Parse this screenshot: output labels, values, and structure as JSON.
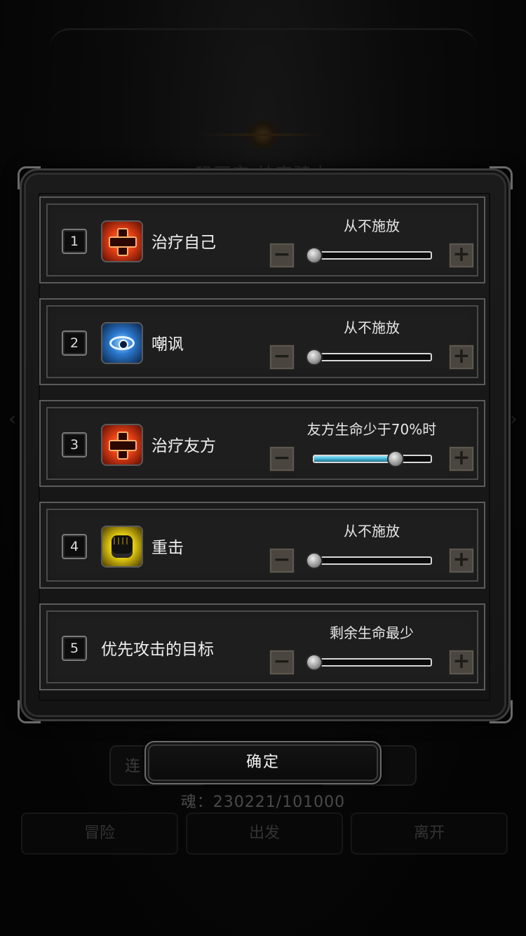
{
  "background": {
    "title": "玛丽安 神官骑士",
    "left_button": "连",
    "soul_text": "魂：230221/101000",
    "nav": [
      "冒险",
      "出发",
      "离开"
    ]
  },
  "skills": [
    {
      "num": "1",
      "name": "治疗自己",
      "setting": "从不施放",
      "level": 0,
      "icon": "heal-cross-icon"
    },
    {
      "num": "2",
      "name": "嘲讽",
      "setting": "从不施放",
      "level": 0,
      "icon": "taunt-eye-icon"
    },
    {
      "num": "3",
      "name": "治疗友方",
      "setting": "友方生命少于70%时",
      "level": 0.7,
      "icon": "heal-cross-icon"
    },
    {
      "num": "4",
      "name": "重击",
      "setting": "从不施放",
      "level": 0,
      "icon": "fist-icon"
    },
    {
      "num": "5",
      "name": "优先攻击的目标",
      "setting": "剩余生命最少",
      "level": 0,
      "icon": null
    }
  ],
  "controls": {
    "minus": "−",
    "plus": "+"
  },
  "confirm_label": "确定"
}
